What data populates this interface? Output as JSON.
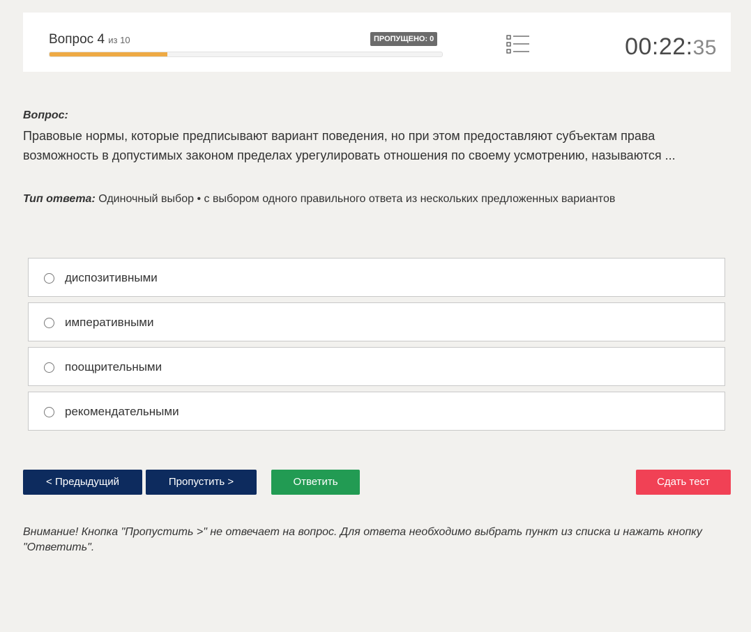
{
  "header": {
    "question_word": "Вопрос 4",
    "question_of": "из 10",
    "skipped_label": "ПРОПУЩЕНО: 0",
    "progress_fraction": 0.3,
    "list_icon": "question-list-icon",
    "timer_main": "00:22:",
    "timer_seconds": "35"
  },
  "question": {
    "label": "Вопрос:",
    "text": "Правовые нормы, которые предписывают вариант поведения, но при этом предоставляют субъектам права возможность в допустимых законом пределах урегулировать отношения по своему усмотрению, называются ..."
  },
  "answer_type": {
    "label": "Тип ответа:",
    "value": "Одиночный выбор • с выбором одного правильного ответа из нескольких предложенных вариантов"
  },
  "options": [
    {
      "label": "диспозитивными"
    },
    {
      "label": "императивными"
    },
    {
      "label": "поощрительными"
    },
    {
      "label": "рекомендательными"
    }
  ],
  "buttons": {
    "prev": "< Предыдущий",
    "skip": "Пропустить >",
    "answer": "Ответить",
    "submit": "Сдать тест"
  },
  "colors": {
    "progress": "#eeaa44",
    "primary": "#0d2b5e",
    "answer": "#229b53",
    "submit": "#f14155"
  },
  "note": "Внимание! Кнопка \"Пропустить >\" не отвечает на вопрос. Для ответа необходимо выбрать пункт из списка и нажать кнопку \"Ответить\"."
}
